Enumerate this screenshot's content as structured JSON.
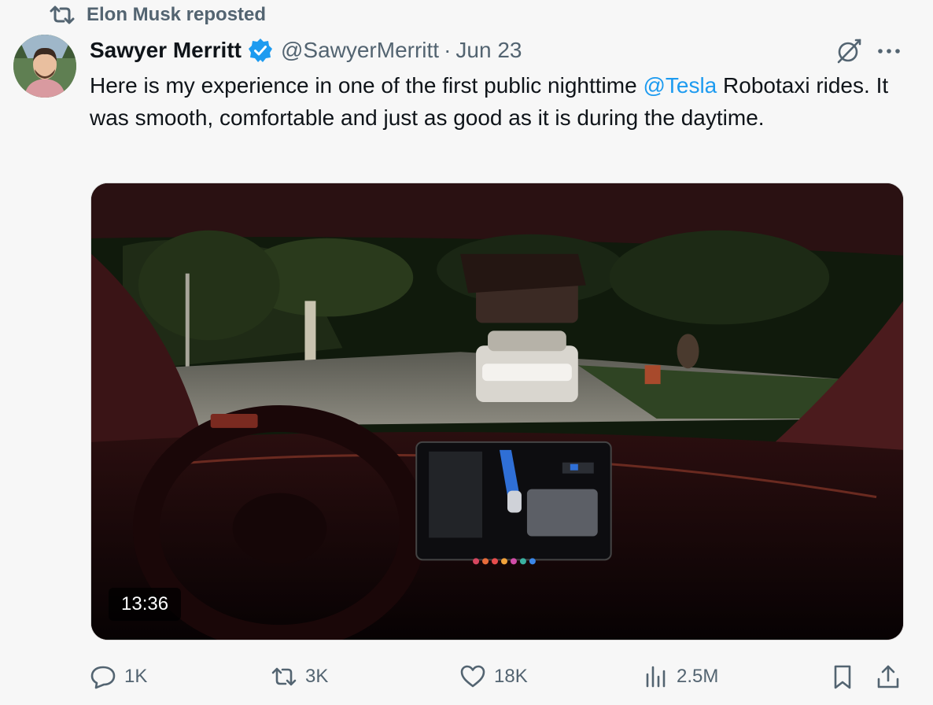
{
  "repost": {
    "label": "Elon Musk reposted",
    "icon": "repost-icon"
  },
  "author": {
    "name": "Sawyer Merritt",
    "verified_icon": "verified-badge-icon",
    "handle": "@SawyerMerritt",
    "separator": "·",
    "date": "Jun 23",
    "avatar_icon": "avatar"
  },
  "header_actions": {
    "grok_icon": "grok-icon",
    "more_icon": "more-icon"
  },
  "tweet": {
    "text_before": "Here is my experience in one of the first public nighttime ",
    "mention": "@Tesla",
    "text_after": " Robotaxi rides. It was smooth, comfortable and just as good as it is during the daytime."
  },
  "media": {
    "duration": "13:36"
  },
  "actions": {
    "replies": "1K",
    "reposts": "3K",
    "likes": "18K",
    "views": "2.5M"
  },
  "colors": {
    "accent": "#1d9bf0",
    "muted": "#536471",
    "background": "#f7f7f7"
  }
}
